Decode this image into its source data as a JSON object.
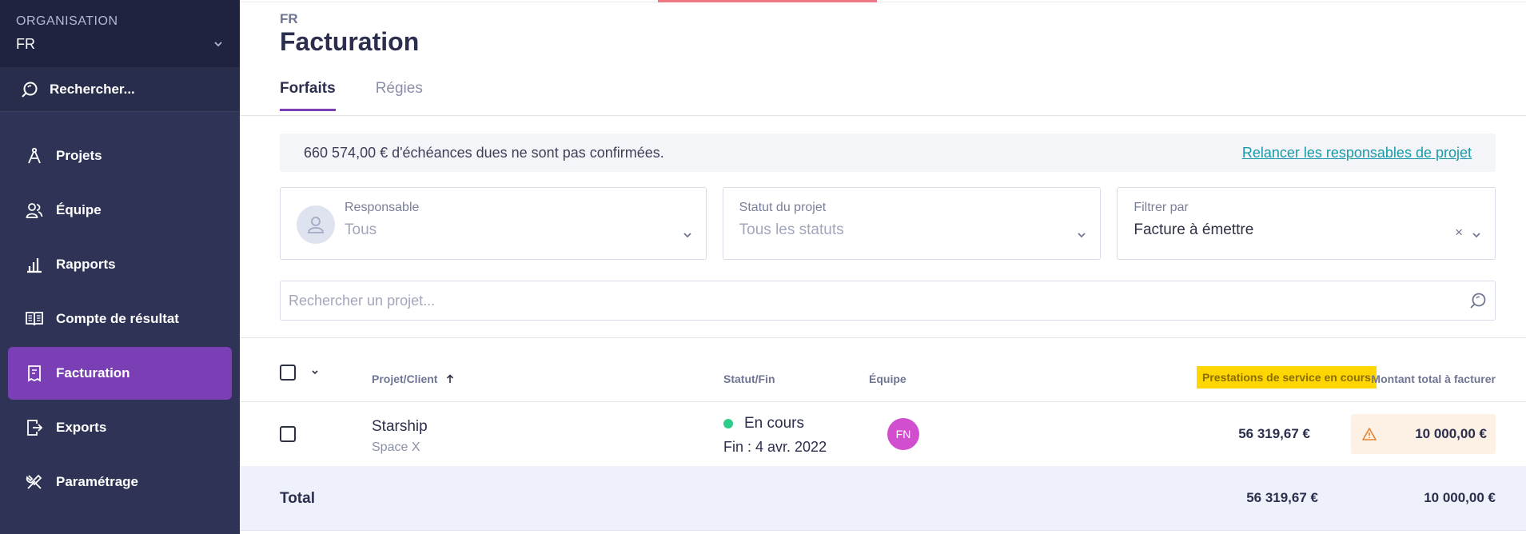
{
  "sidebar": {
    "org_label": "ORGANISATION",
    "org_value": "FR",
    "search_label": "Rechercher...",
    "items": [
      {
        "label": "Projets",
        "icon": "compass-icon"
      },
      {
        "label": "Équipe",
        "icon": "team-icon"
      },
      {
        "label": "Rapports",
        "icon": "bar-chart-icon"
      },
      {
        "label": "Compte de résultat",
        "icon": "book-icon"
      },
      {
        "label": "Facturation",
        "icon": "invoice-icon",
        "active": true
      },
      {
        "label": "Exports",
        "icon": "export-icon"
      },
      {
        "label": "Paramétrage",
        "icon": "tools-icon"
      }
    ]
  },
  "header": {
    "org_code": "FR",
    "title": "Facturation",
    "tabs": [
      {
        "label": "Forfaits",
        "active": true
      },
      {
        "label": "Régies",
        "active": false
      }
    ]
  },
  "banner": {
    "text": "660 574,00 € d'échéances dues ne sont pas confirmées.",
    "link": "Relancer les responsables de projet"
  },
  "filters": {
    "responsable": {
      "label": "Responsable",
      "value": "Tous"
    },
    "statut": {
      "label": "Statut du projet",
      "value": "Tous les statuts"
    },
    "filtrer": {
      "label": "Filtrer par",
      "value": "Facture à émettre",
      "clear": "×"
    }
  },
  "search": {
    "placeholder": "Rechercher un projet..."
  },
  "table": {
    "headers": {
      "projet": "Projet/Client",
      "statut": "Statut/Fin",
      "equipe": "Équipe",
      "prestations": "Prestations de service en cours",
      "montant": "Montant total à facturer"
    },
    "rows": [
      {
        "project": "Starship",
        "client": "Space X",
        "status": "En cours",
        "end": "Fin : 4 avr. 2022",
        "team_initials": "FN",
        "prestations": "56 319,67 €",
        "montant": "10 000,00 €"
      }
    ],
    "total": {
      "label": "Total",
      "prestations": "56 319,67 €",
      "montant": "10 000,00 €"
    }
  },
  "colors": {
    "sidebar_bg": "#2f3456",
    "active_nav": "#7a3fb4",
    "link": "#1a9aa8",
    "highlight": "#ffd600",
    "status_green": "#2ecc8b",
    "avatar_pink": "#d14fcf"
  }
}
